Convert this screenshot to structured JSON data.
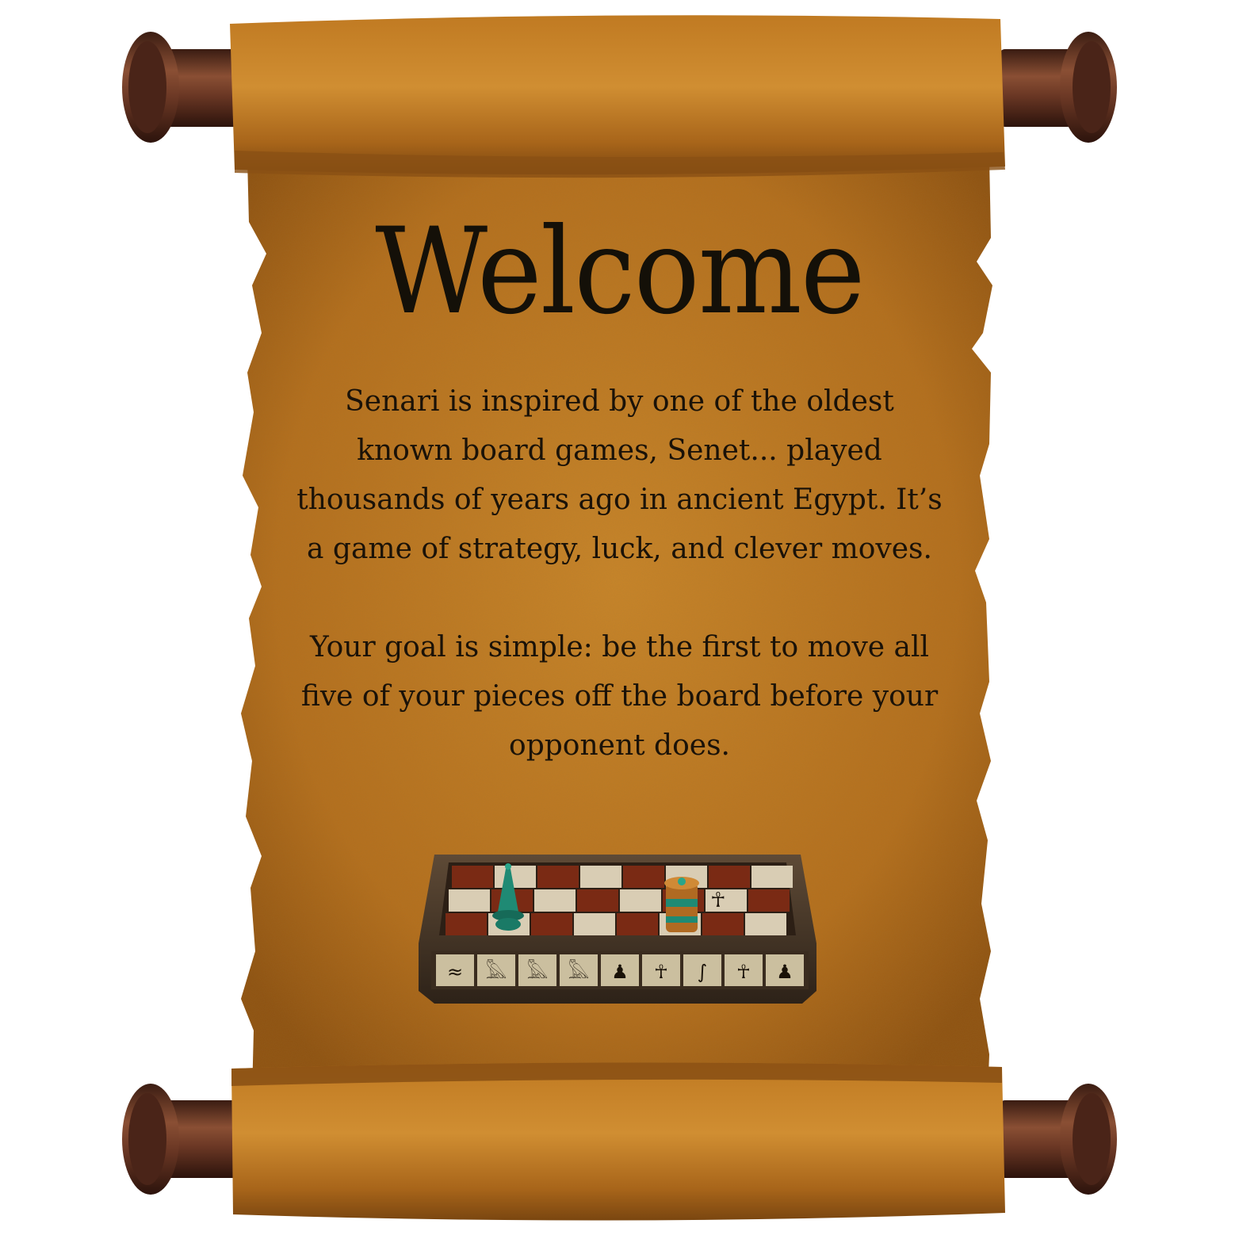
{
  "title": "Welcome",
  "intro_lines": [
    "Senari is inspired by one of the oldest",
    "known board games, Senet... played",
    "thousands of years ago in ancient Egypt. It’s",
    "a game of strategy, luck, and clever moves."
  ],
  "goal_lines": [
    "Your goal is simple: be the first to move all",
    "five of your pieces off the board before your",
    "opponent does."
  ],
  "board": {
    "rows": 3,
    "cols": 8,
    "hieroglyph_icons": [
      "water-icon",
      "bird-icon",
      "bird-icon",
      "bird-icon",
      "seated-figure-icon",
      "ankh-icon",
      "snake-icon",
      "ankh-icon",
      "seated-figure-icon"
    ],
    "pieces": [
      {
        "type": "cone",
        "color": "#1f8a74",
        "icon": "cone-piece-icon"
      },
      {
        "type": "spool",
        "color": "#b06a22",
        "icon": "spool-piece-icon"
      }
    ],
    "square_symbol": "☥"
  },
  "colors": {
    "parchment": "#b97520",
    "parchment_light": "#d08a2c",
    "roller_wood": "#5a2f1e",
    "ink": "#141008"
  }
}
